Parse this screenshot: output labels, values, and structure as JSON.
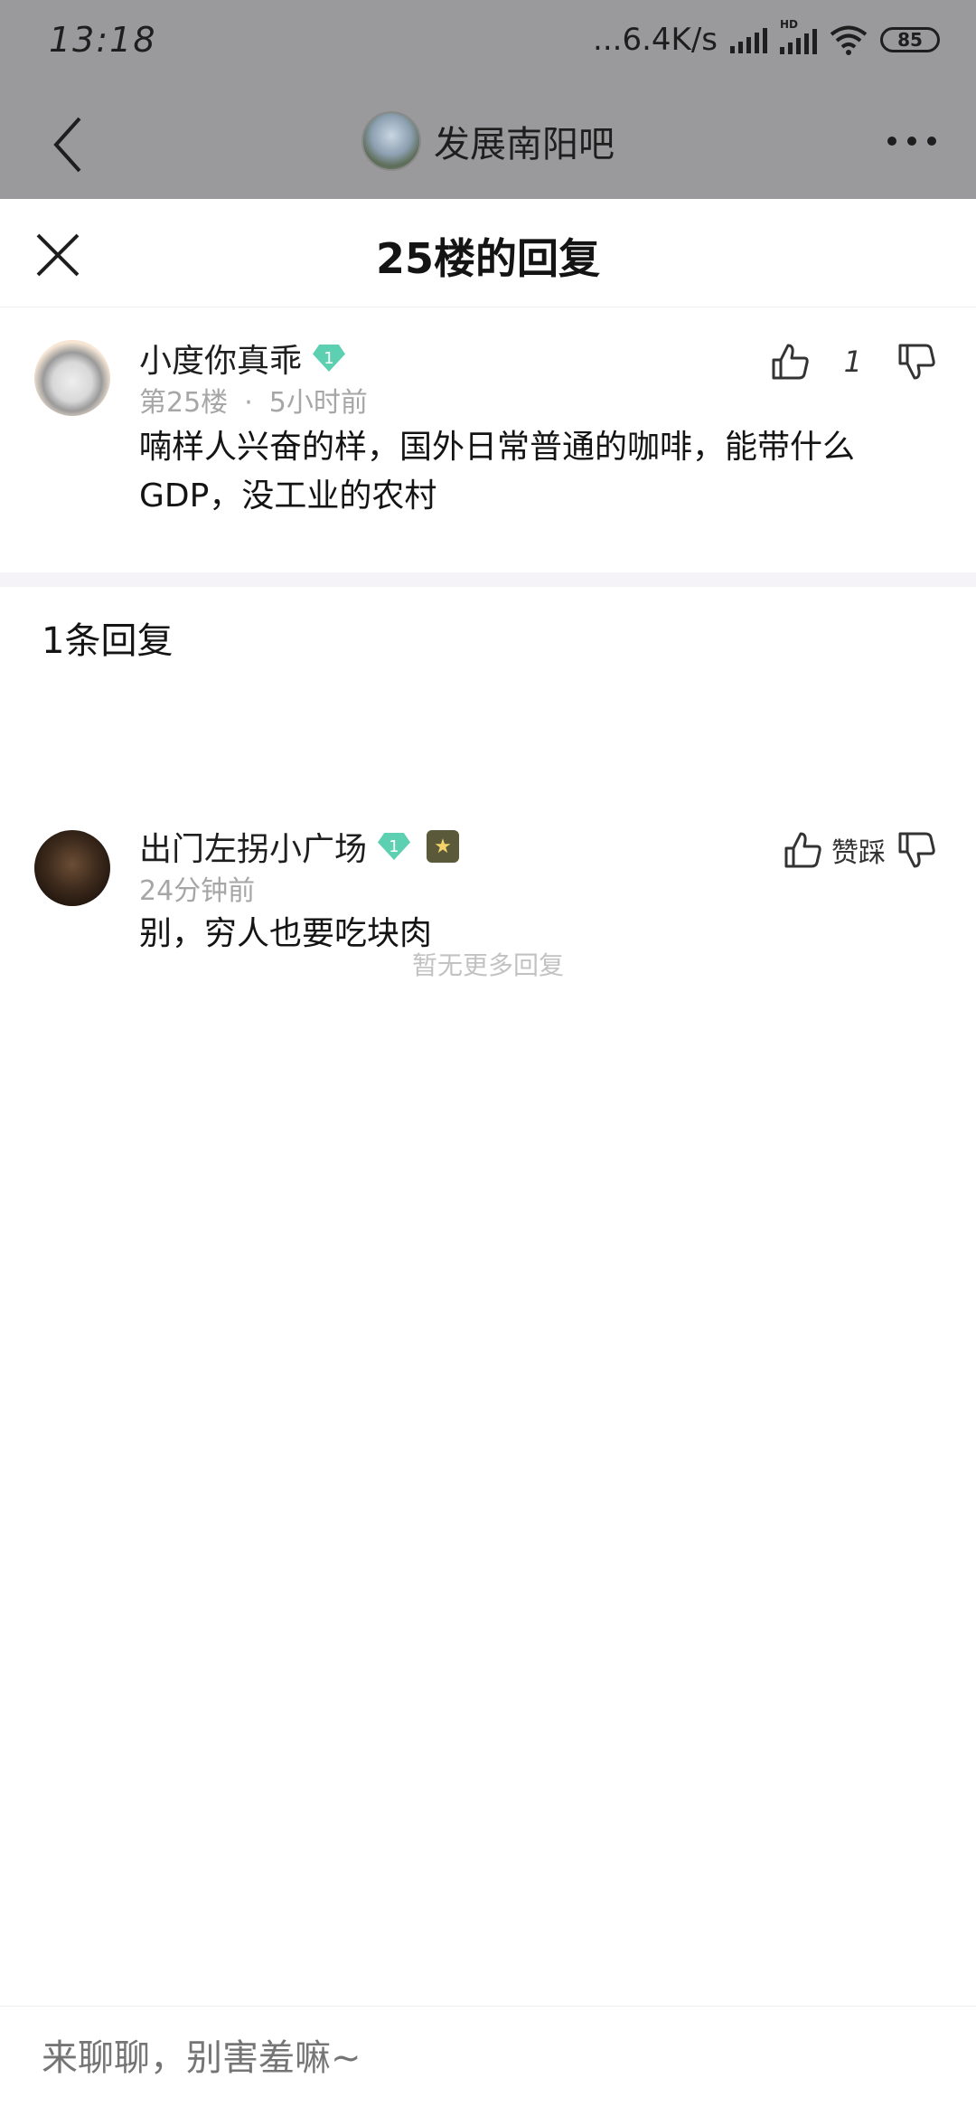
{
  "status_bar": {
    "time": "13:18",
    "speed": "...6.4K/s",
    "hd": "HD",
    "battery": "85"
  },
  "nav": {
    "forum_name": "发展南阳吧"
  },
  "sheet": {
    "title": "25楼的回复"
  },
  "main_comment": {
    "username": "小度你真乖",
    "level": "1",
    "floor": "第25楼",
    "dot": "·",
    "time": "5小时前",
    "content": "喃样人兴奋的样，国外日常普通的咖啡，能带什么GDP，没工业的农村",
    "like_count": "1"
  },
  "replies": {
    "count_label": "1条回复",
    "items": [
      {
        "username": "出门左拐小广场",
        "level": "1",
        "time": "24分钟前",
        "content": "别，穷人也要吃块肉",
        "dislike_label": "赞踩"
      }
    ],
    "no_more": "暂无更多回复"
  },
  "input": {
    "placeholder": "来聊聊，别害羞嘛~"
  }
}
